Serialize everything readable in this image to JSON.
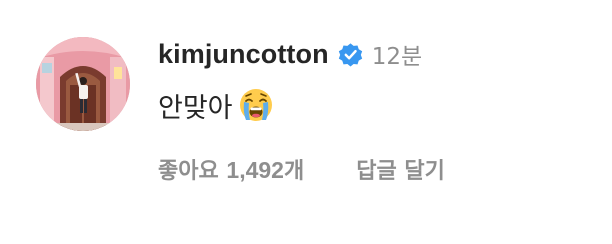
{
  "comment": {
    "username": "kimjuncotton",
    "verified_icon": "verified-badge-icon",
    "time": "12분",
    "text": "안맞아",
    "emoji": "loudly-crying-face",
    "likes_prefix": "좋아요",
    "likes_count": "1,492",
    "likes_suffix": "개",
    "reply_label": "답글 달기"
  },
  "colors": {
    "text_primary": "#262626",
    "text_secondary": "#8e8e8e",
    "verified_blue": "#3897f0"
  }
}
